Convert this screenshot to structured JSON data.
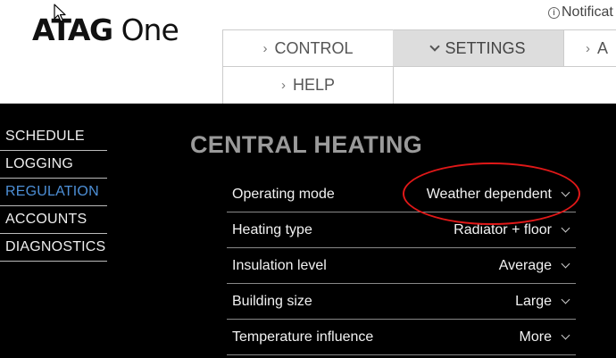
{
  "header": {
    "logo_brand": "ATAG",
    "logo_product": "One",
    "notification_label": "Notificat"
  },
  "nav": {
    "control": "CONTROL",
    "settings": "SETTINGS",
    "third": "A",
    "help": "HELP"
  },
  "sidebar": {
    "items": [
      {
        "label": "SCHEDULE",
        "active": false
      },
      {
        "label": "LOGGING",
        "active": false
      },
      {
        "label": "REGULATION",
        "active": true
      },
      {
        "label": "ACCOUNTS",
        "active": false
      },
      {
        "label": "DIAGNOSTICS",
        "active": false
      }
    ]
  },
  "main": {
    "title": "CENTRAL HEATING",
    "settings": [
      {
        "label": "Operating mode",
        "value": "Weather dependent"
      },
      {
        "label": "Heating type",
        "value": "Radiator + floor"
      },
      {
        "label": "Insulation level",
        "value": "Average"
      },
      {
        "label": "Building size",
        "value": "Large"
      },
      {
        "label": "Temperature influence",
        "value": "More"
      }
    ]
  },
  "colors": {
    "active_link": "#4d8fd6",
    "highlight_ring": "#e01818",
    "background": "#000000"
  }
}
